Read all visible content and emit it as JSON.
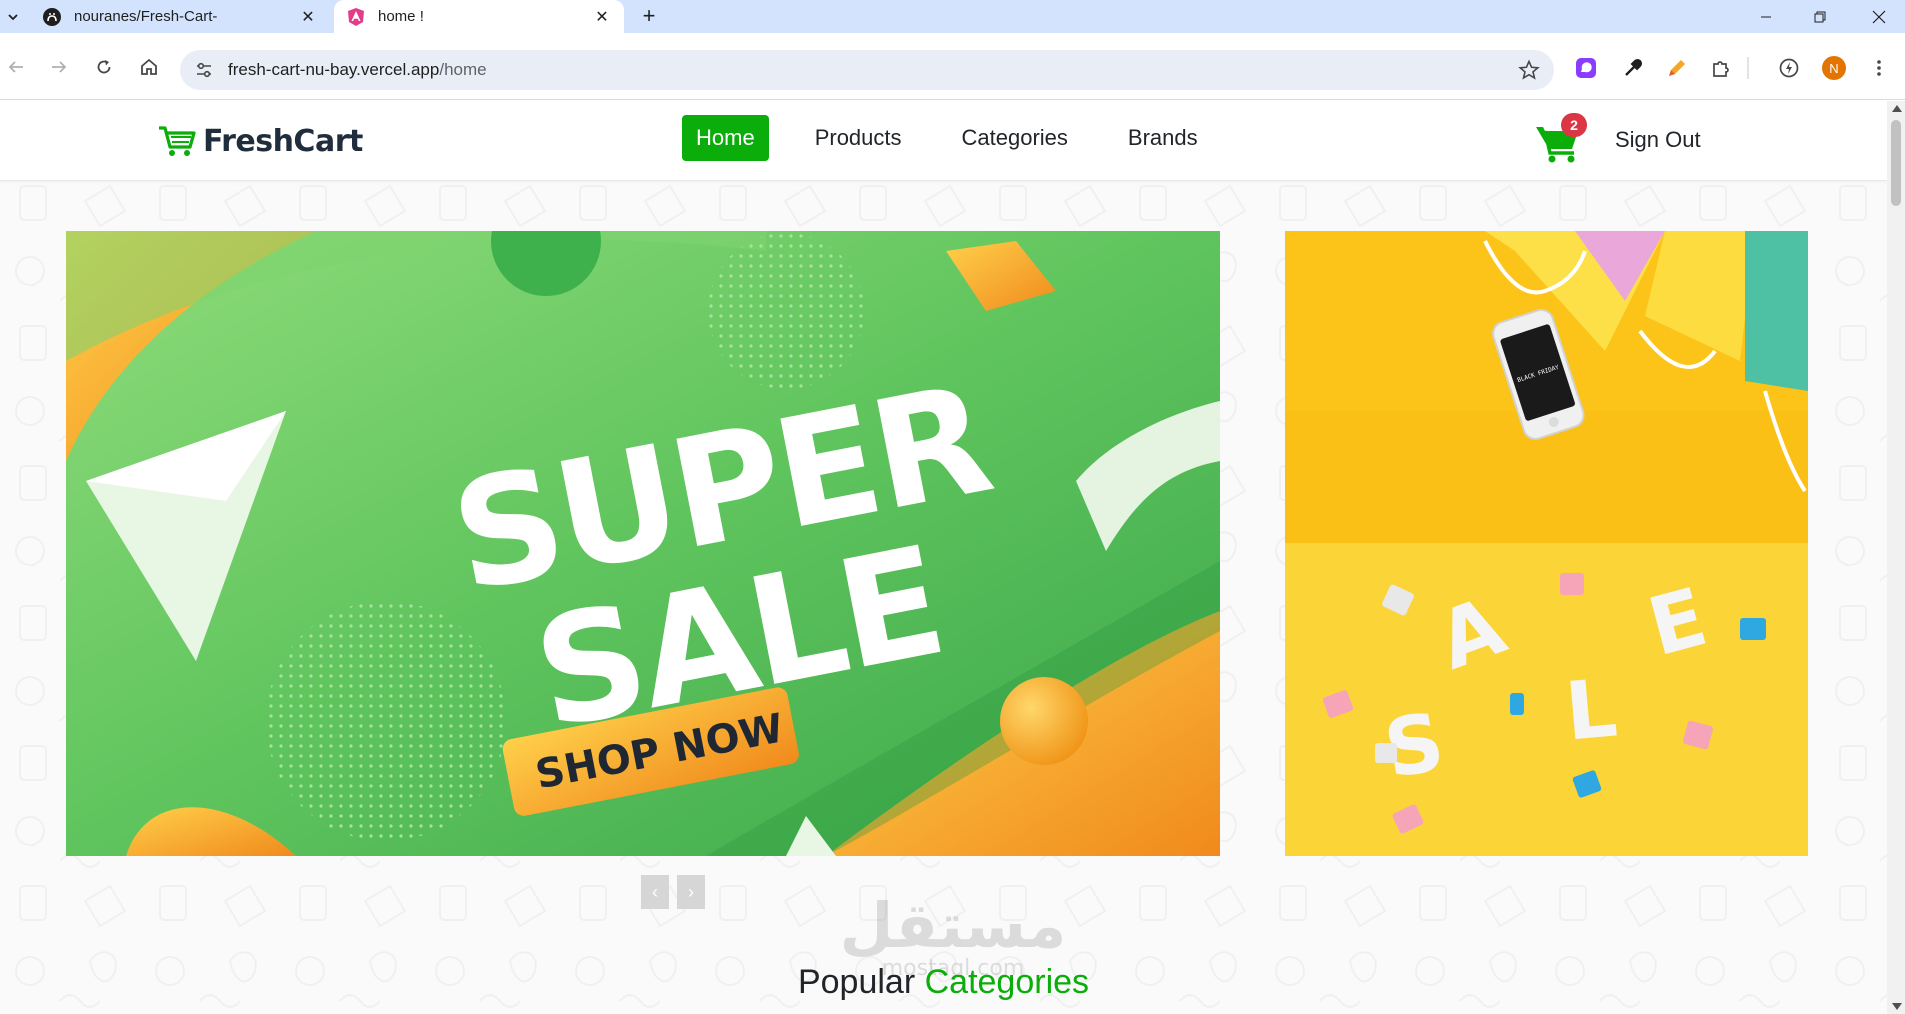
{
  "browser": {
    "tabs": [
      {
        "title": "nouranes/Fresh-Cart-",
        "icon": "github-icon",
        "active": false
      },
      {
        "title": "home !",
        "icon": "angular-icon",
        "active": true
      }
    ],
    "url_host": "fresh-cart-nu-bay.vercel.app",
    "url_path": "/home",
    "profile_initial": "N"
  },
  "site": {
    "logo_text": "FreshCart",
    "nav": [
      {
        "label": "Home",
        "active": true
      },
      {
        "label": "Products",
        "active": false
      },
      {
        "label": "Categories",
        "active": false
      },
      {
        "label": "Brands",
        "active": false
      }
    ],
    "cart_count": "2",
    "sign_out_label": "Sign Out",
    "brand_color": "#0aad0a"
  },
  "hero": {
    "main_banner": {
      "line1": "SUPER",
      "line2": "SALE",
      "cta": "SHOP NOW"
    },
    "side_top": {
      "phone_text": "BLACK FRIDAY"
    },
    "side_bottom": {
      "letters": [
        "S",
        "A",
        "L",
        "E"
      ]
    },
    "prev_label": "‹",
    "next_label": "›"
  },
  "section": {
    "title_plain": "Popular",
    "title_accent": "Categories"
  },
  "watermark": {
    "arabic": "مستقل",
    "latin": "mostaql.com"
  }
}
